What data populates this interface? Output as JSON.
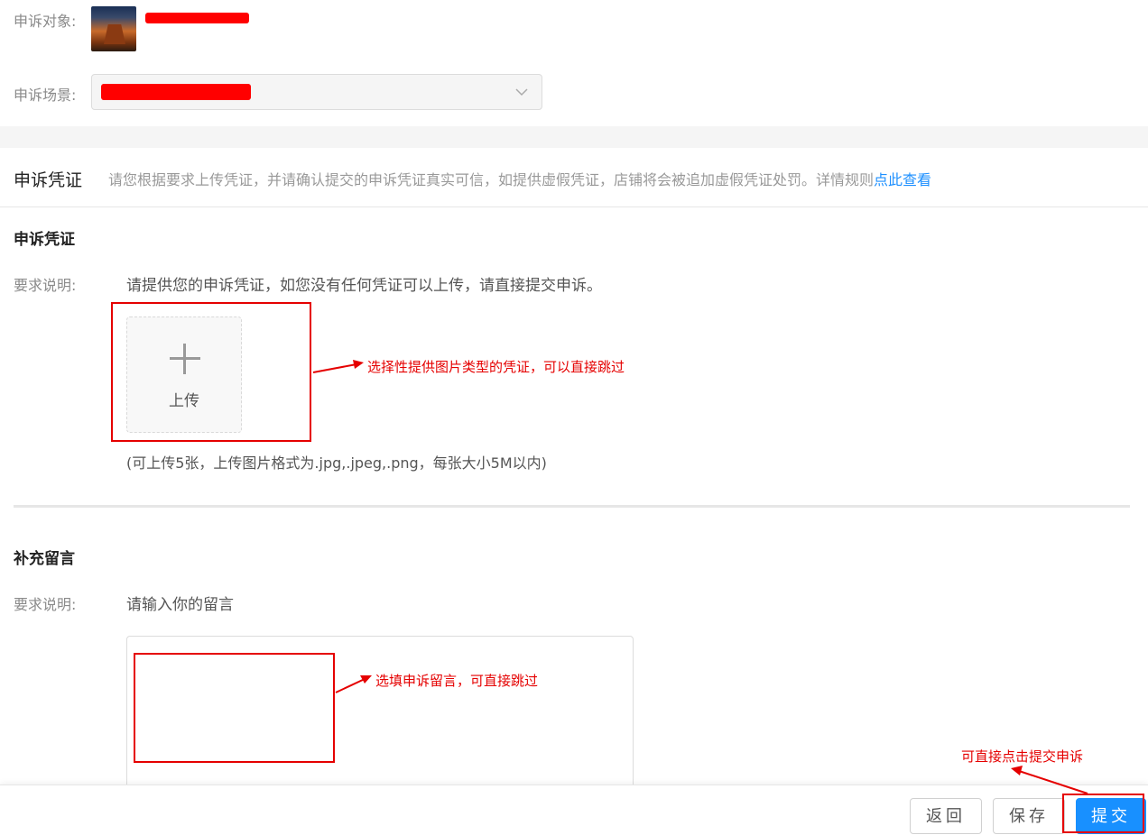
{
  "appeal_target": {
    "label": "申诉对象:"
  },
  "appeal_scene": {
    "label": "申诉场景:"
  },
  "evidence_header": {
    "title": "申诉凭证",
    "notice": "请您根据要求上传凭证，并请确认提交的申诉凭证真实可信，如提供虚假凭证，店铺将会被追加虚假凭证处罚。详情规则",
    "link": "点此查看"
  },
  "evidence": {
    "title": "申诉凭证",
    "req_label": "要求说明:",
    "req_text": "请提供您的申诉凭证，如您没有任何凭证可以上传，请直接提交申诉。",
    "upload_label": "上传",
    "hint": "(可上传5张，上传图片格式为.jpg,.jpeg,.png，每张大小5M以内)"
  },
  "message": {
    "title": "补充留言",
    "req_label": "要求说明:",
    "req_text": "请输入你的留言"
  },
  "annotations": {
    "upload": "选择性提供图片类型的凭证，可以直接跳过",
    "message": "选填申诉留言，可直接跳过",
    "submit": "可直接点击提交申诉"
  },
  "footer": {
    "back": "返回",
    "save": "保存",
    "submit": "提交"
  },
  "colors": {
    "primary": "#1890ff",
    "annotation": "#e50000",
    "link": "#1e90ff"
  },
  "icons": {
    "upload": "plus-icon",
    "dropdown": "chevron-down-icon"
  }
}
